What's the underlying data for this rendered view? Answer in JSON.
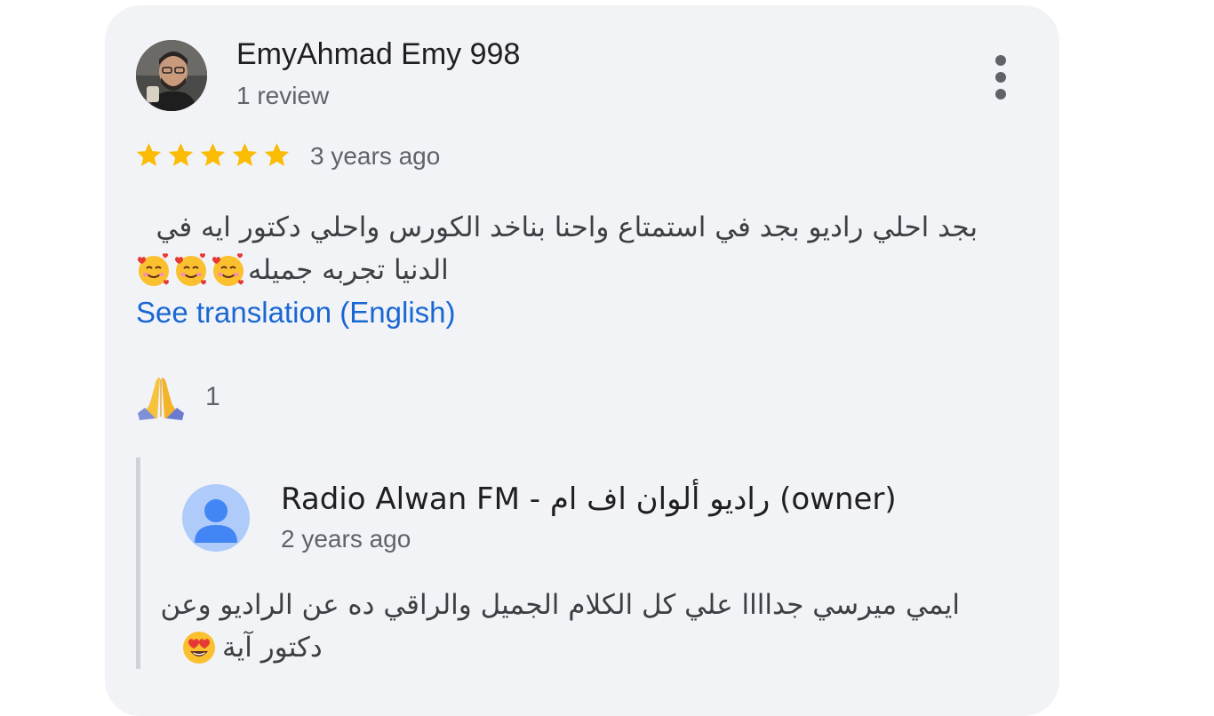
{
  "review": {
    "reviewer_name": "EmyAhmad Emy 998",
    "review_count": "1 review",
    "rating": 5,
    "rating_max": 5,
    "date": "3 years ago",
    "text_line1": "بجد احلي راديو بجد في استمتاع واحنا بناخد الكورس واحلي دكتور ايه في",
    "text_line2": "الدنيا تجربه جميله",
    "text_emojis": [
      "smiling-face-with-hearts",
      "smiling-face-with-hearts",
      "smiling-face-with-hearts"
    ],
    "see_translation_label": "See translation (English)",
    "reaction_icon": "folded-hands-icon",
    "reaction_count": "1",
    "more_icon": "more-vertical-icon"
  },
  "owner_reply": {
    "name": "Radio Alwan FM - راديو ألوان اف ام (owner)",
    "date": "2 years ago",
    "text_line1": "ايمي ميرسي جداااا علي كل الكلام الجميل والراقي ده عن الراديو وعن",
    "text_line2": "دكتور آية",
    "text_emoji": "smiling-face-with-heart-eyes",
    "avatar_icon": "person-icon"
  },
  "colors": {
    "card_background": "#f2f3f7",
    "star": "#fbbc04",
    "link": "#1967d2",
    "secondary_text": "#5f6368",
    "owner_avatar": "#aecbfa",
    "owner_avatar_glyph": "#4285f4"
  }
}
